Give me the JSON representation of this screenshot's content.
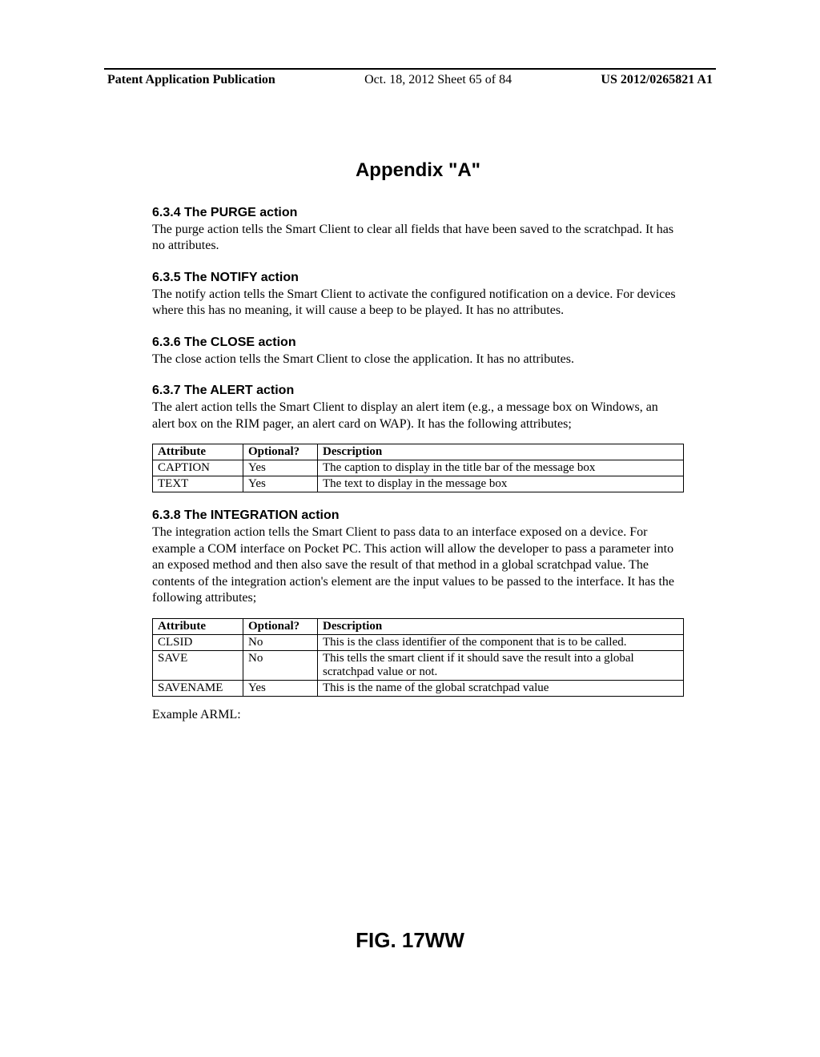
{
  "header": {
    "left": "Patent Application Publication",
    "center": "Oct. 18, 2012  Sheet 65 of 84",
    "right": "US 2012/0265821 A1"
  },
  "appendix_title": "Appendix \"A\"",
  "sections": {
    "s634": {
      "heading": "6.3.4  The PURGE action",
      "body": "The purge action tells the Smart Client to clear all fields that have been saved to the scratchpad. It has no attributes."
    },
    "s635": {
      "heading": "6.3.5  The NOTIFY action",
      "body": "The notify action tells the Smart Client to activate the configured notification on a device. For devices where this has no meaning, it will cause a beep to be played. It has no attributes."
    },
    "s636": {
      "heading": "6.3.6  The CLOSE action",
      "body": "The close action tells the Smart Client to close the application. It has no attributes."
    },
    "s637": {
      "heading": "6.3.7  The ALERT action",
      "body": "The alert action tells the Smart Client to display an alert item (e.g., a message box on Windows, an alert box on the RIM pager, an alert card on WAP). It has the following attributes;"
    },
    "s638": {
      "heading": "6.3.8  The INTEGRATION action",
      "body": "The integration action tells the Smart Client to pass data to an interface exposed on a device.  For example a COM interface on Pocket PC.  This action will allow the developer to pass a parameter into an exposed method and then also save the result of that method in a global scratchpad value.  The contents of the integration action's element are the input values to be passed to the interface. It has the following attributes;"
    }
  },
  "table_headers": {
    "attribute": "Attribute",
    "optional": "Optional?",
    "description": "Description"
  },
  "alert_table": [
    {
      "attr": "CAPTION",
      "opt": "Yes",
      "desc": "The caption to display in the title bar of the message box"
    },
    {
      "attr": "TEXT",
      "opt": "Yes",
      "desc": "The text to display in the message box"
    }
  ],
  "integration_table": [
    {
      "attr": "CLSID",
      "opt": "No",
      "desc": "This is the class identifier of the component that is to be called."
    },
    {
      "attr": "SAVE",
      "opt": "No",
      "desc": "This tells the smart client if it should save the result into a global scratchpad value or not."
    },
    {
      "attr": "SAVENAME",
      "opt": "Yes",
      "desc": "This is the name of the global scratchpad value"
    }
  ],
  "example_label": "Example ARML:",
  "figure_label": "FIG. 17WW"
}
